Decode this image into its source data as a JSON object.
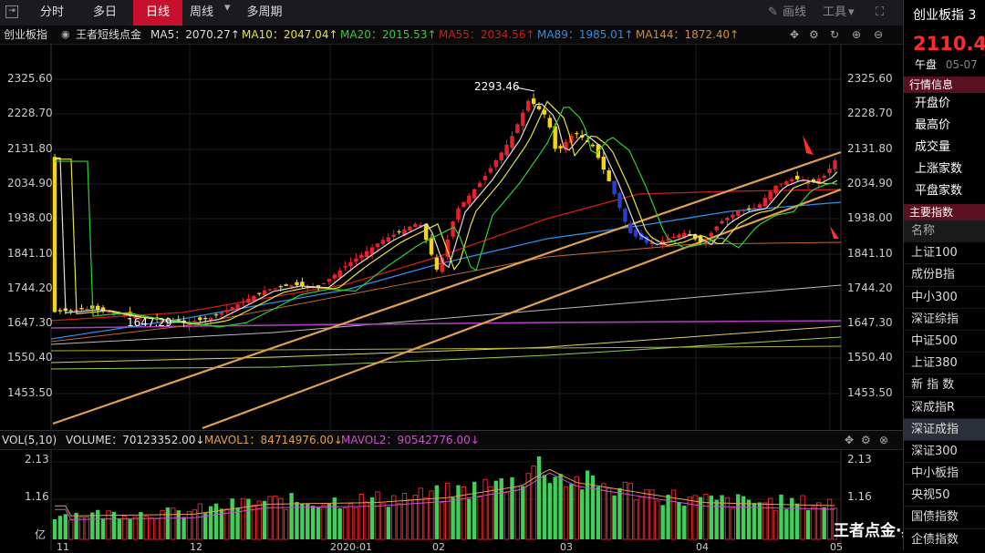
{
  "toolbar": {
    "tabs": [
      {
        "label": "分时"
      },
      {
        "label": "多日"
      },
      {
        "label": "日线"
      },
      {
        "label": "周线"
      },
      {
        "label": "多周期"
      }
    ],
    "draw_label": "画线",
    "tools_label": "工具"
  },
  "indicator_bar": {
    "index_name": "创业板指",
    "indicator_name": "王者短线点金",
    "ma5": "MA5：2070.27↑",
    "ma10": "MA10：2047.04↑",
    "ma20": "MA20：2015.53↑",
    "ma55": "MA55：2034.56↑",
    "ma89": "MA89：1985.01↑",
    "ma144": "MA144：1872.40↑"
  },
  "price_axis": {
    "labels": [
      "2325.60",
      "2228.70",
      "2131.80",
      "2034.90",
      "1938.00",
      "1841.10",
      "1744.20",
      "1647.30",
      "1550.40",
      "1453.50"
    ]
  },
  "annotations": {
    "high": "2293.46",
    "low": "1647.29"
  },
  "volume_bar": {
    "title": "VOL(5,10)",
    "volume": "VOLUME：70123352.00↓",
    "mavol1": "MAVOL1：84714976.00↓",
    "mavol2": "MAVOL2：90542776.00↓",
    "axis_labels": [
      "2.13",
      "1.16"
    ],
    "unit": "亿"
  },
  "date_axis": {
    "labels": [
      "11",
      "12",
      "2020-01",
      "02",
      "03",
      "04",
      "05"
    ]
  },
  "watermark": "王者点金·典藏版",
  "right_panel": {
    "title": "创业板指 3",
    "price": "2110.4",
    "session": "午盘",
    "date": "05-07",
    "quote_header": "行情信息",
    "quote_items": [
      "开盘价",
      "最高价",
      "成交量",
      "上涨家数",
      "平盘家数"
    ],
    "index_header": "主要指数",
    "index_items": [
      "名称",
      "上证100",
      "成份B指",
      "中小300",
      "深证综指",
      "中证500",
      "上证380",
      "新 指 数",
      "深成指R",
      "深证成指",
      "深证300",
      "中小板指",
      "央视50",
      "国债指数",
      "企债指数"
    ],
    "selected_index": "深证成指"
  },
  "colors": {
    "up": "#e8212e",
    "down_candle": "#f5d511",
    "down_blue": "#2a3bd6",
    "ma5": "#dddddd",
    "ma10": "#e8e23a",
    "ma20": "#2fd12f",
    "ma55": "#d01c1c",
    "ma89": "#2e8de8",
    "ma144": "#d98a3a",
    "trend": "#e0a050"
  }
}
